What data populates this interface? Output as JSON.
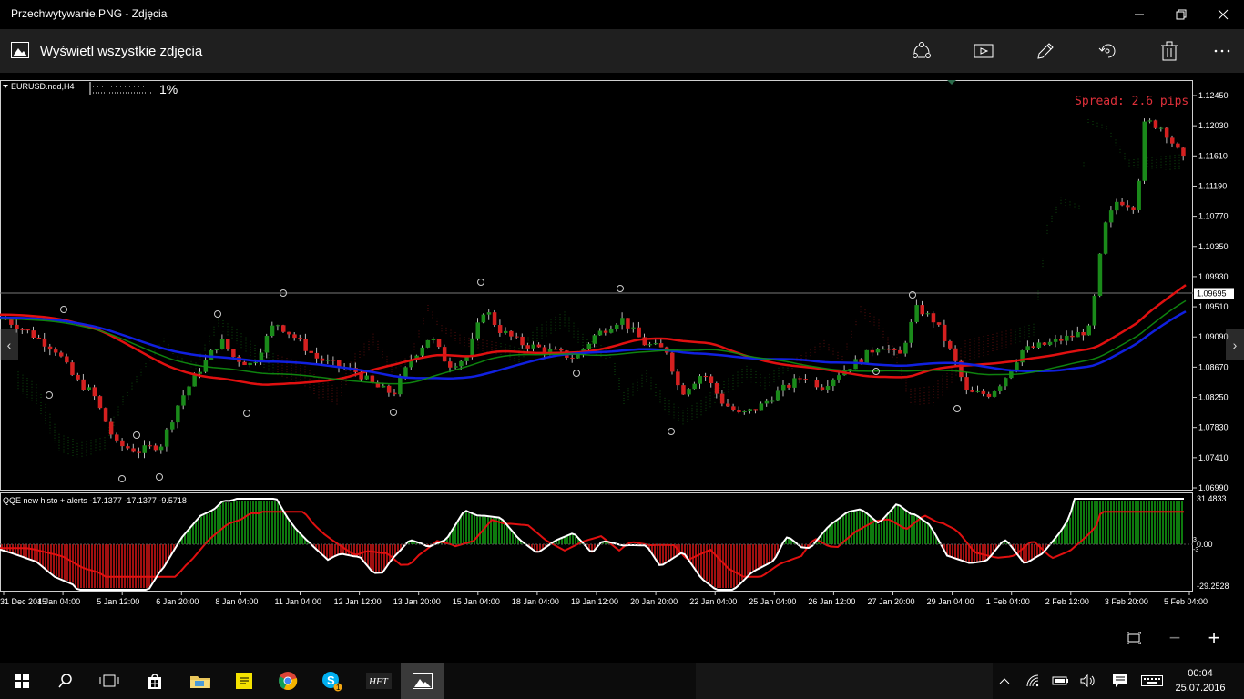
{
  "window": {
    "title": "Przechwytywanie.PNG - Zdjęcia"
  },
  "appbar": {
    "label": "Wyświetl wszystkie zdjęcia"
  },
  "chart": {
    "symbol": "EURUSD.ndd,H4",
    "risk_percent": "1%",
    "spread": "Spread: 2.6 pips",
    "current_price": "1.09695",
    "price_ticks": [
      "1.12450",
      "1.12030",
      "1.11610",
      "1.11190",
      "1.10770",
      "1.10350",
      "1.09930",
      "1.09510",
      "1.09090",
      "1.08670",
      "1.08250",
      "1.07830",
      "1.07410",
      "1.06990"
    ],
    "time_ticks": [
      "31 Dec 2015",
      "4 Jan 04:00",
      "5 Jan 12:00",
      "6 Jan 20:00",
      "8 Jan 04:00",
      "11 Jan 04:00",
      "12 Jan 12:00",
      "13 Jan 20:00",
      "15 Jan 04:00",
      "18 Jan 04:00",
      "19 Jan 12:00",
      "20 Jan 20:00",
      "22 Jan 04:00",
      "25 Jan 04:00",
      "26 Jan 12:00",
      "27 Jan 20:00",
      "29 Jan 04:00",
      "1 Feb 04:00",
      "2 Feb 12:00",
      "3 Feb 20:00",
      "5 Feb 04:00"
    ],
    "indicator_label": "QQE new histo + alerts -17.1377 -17.1377 -9.5718",
    "indicator_ticks": [
      "31.4833",
      "0.00",
      "-29.2528"
    ],
    "indicator_small_ticks": [
      "3",
      "-3"
    ]
  },
  "taskbar": {
    "time": "00:04",
    "date": "25.07.2016",
    "skype_badge": "1"
  },
  "colors": {
    "bull": "#1a8a1a",
    "bear": "#d42020",
    "ma_red": "#e01010",
    "ma_blue": "#1020e0",
    "ma_green": "#109010"
  }
}
